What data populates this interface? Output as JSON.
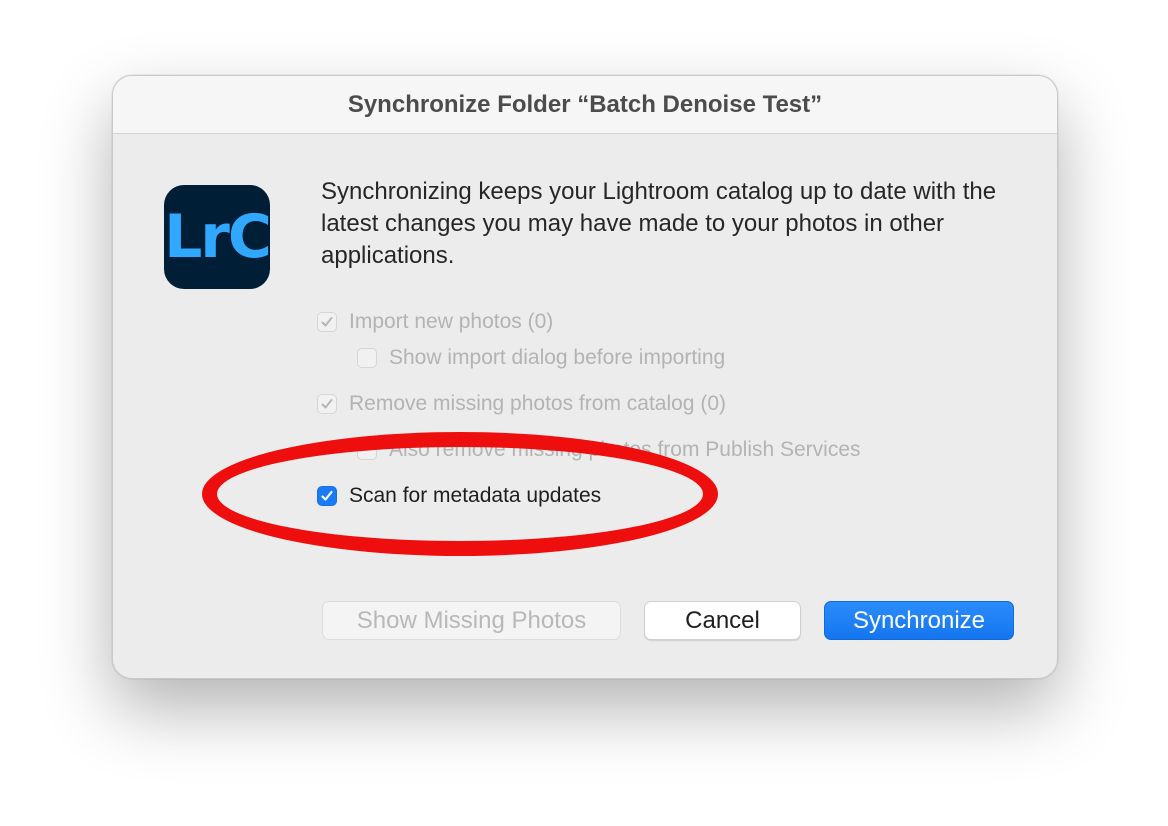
{
  "dialog": {
    "title": "Synchronize Folder “Batch Denoise Test”",
    "app_icon": {
      "name": "lightroom-classic-icon",
      "label": "LrC",
      "bg_color": "#001e36",
      "text_color": "#31a8ff"
    },
    "message": "Synchronizing keeps your Lightroom catalog up to date with the latest changes you may have made to your photos in other applications.",
    "options": [
      {
        "label": "Import new photos (0)",
        "checked": true,
        "enabled": false
      },
      {
        "label": "Show import dialog before importing",
        "checked": false,
        "enabled": false
      },
      {
        "label": "Remove missing photos from catalog (0)",
        "checked": true,
        "enabled": false
      },
      {
        "label": "Also remove missing photos from Publish Services",
        "checked": false,
        "enabled": false
      },
      {
        "label": "Scan for metadata updates",
        "checked": true,
        "enabled": true
      }
    ],
    "buttons": {
      "show_missing": "Show Missing Photos",
      "cancel": "Cancel",
      "synchronize": "Synchronize"
    }
  },
  "colors": {
    "accent": "#1a7cf5",
    "annotation": "#ee0e0e"
  }
}
